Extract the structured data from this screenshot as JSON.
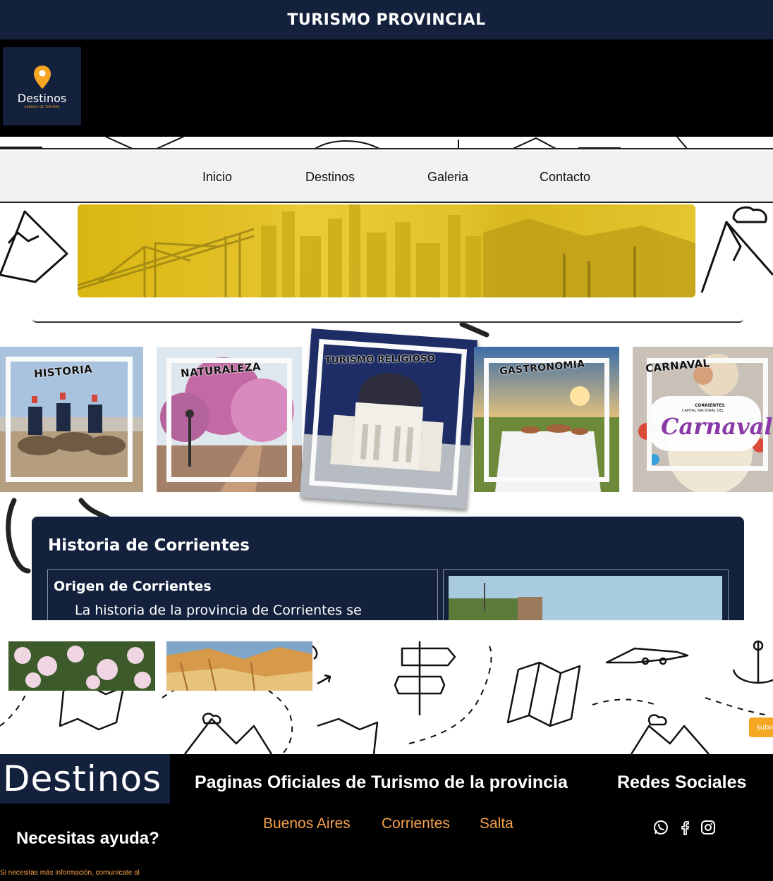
{
  "site": {
    "title": "TURISMO PROVINCIAL",
    "logo": {
      "name": "Destinos",
      "tagline": "AGENCIA DE TURISMO"
    }
  },
  "nav": {
    "items": [
      {
        "label": "Inicio"
      },
      {
        "label": "Destinos"
      },
      {
        "label": "Galeria"
      },
      {
        "label": "Contacto"
      }
    ]
  },
  "categories": [
    {
      "label": "HISTORIA"
    },
    {
      "label": "NATURALEZA"
    },
    {
      "label": "TURISMO RELIGIOSO"
    },
    {
      "label": "GASTRONOMIA"
    },
    {
      "label": "CARNAVAL",
      "badge_top": "CORRIENTES",
      "badge_mid": "CAPITAL NACIONAL DEL",
      "badge_word": "Carnaval"
    }
  ],
  "history": {
    "title": "Historia de Corrientes",
    "card_title": "Origen de Corrientes",
    "card_text": "La historia de la provincia de Corrientes se"
  },
  "scroll_top": {
    "label": "subir"
  },
  "footer": {
    "logo": "Destinos",
    "links_title": "Paginas Oficiales de Turismo de la provincia",
    "links": [
      {
        "label": "Buenos Aires"
      },
      {
        "label": "Corrientes"
      },
      {
        "label": "Salta"
      }
    ],
    "social_title": "Redes Sociales",
    "social_icons": [
      "whatsapp-icon",
      "facebook-icon",
      "instagram-icon"
    ],
    "help_title": "Necesitas ayuda?",
    "help_note": "Si necesitas más información, comunícate al"
  },
  "colors": {
    "navy": "#14213d",
    "accent": "#f5a623",
    "banner_yellow": "#e2c32c",
    "link_orange": "#f5a04a"
  }
}
